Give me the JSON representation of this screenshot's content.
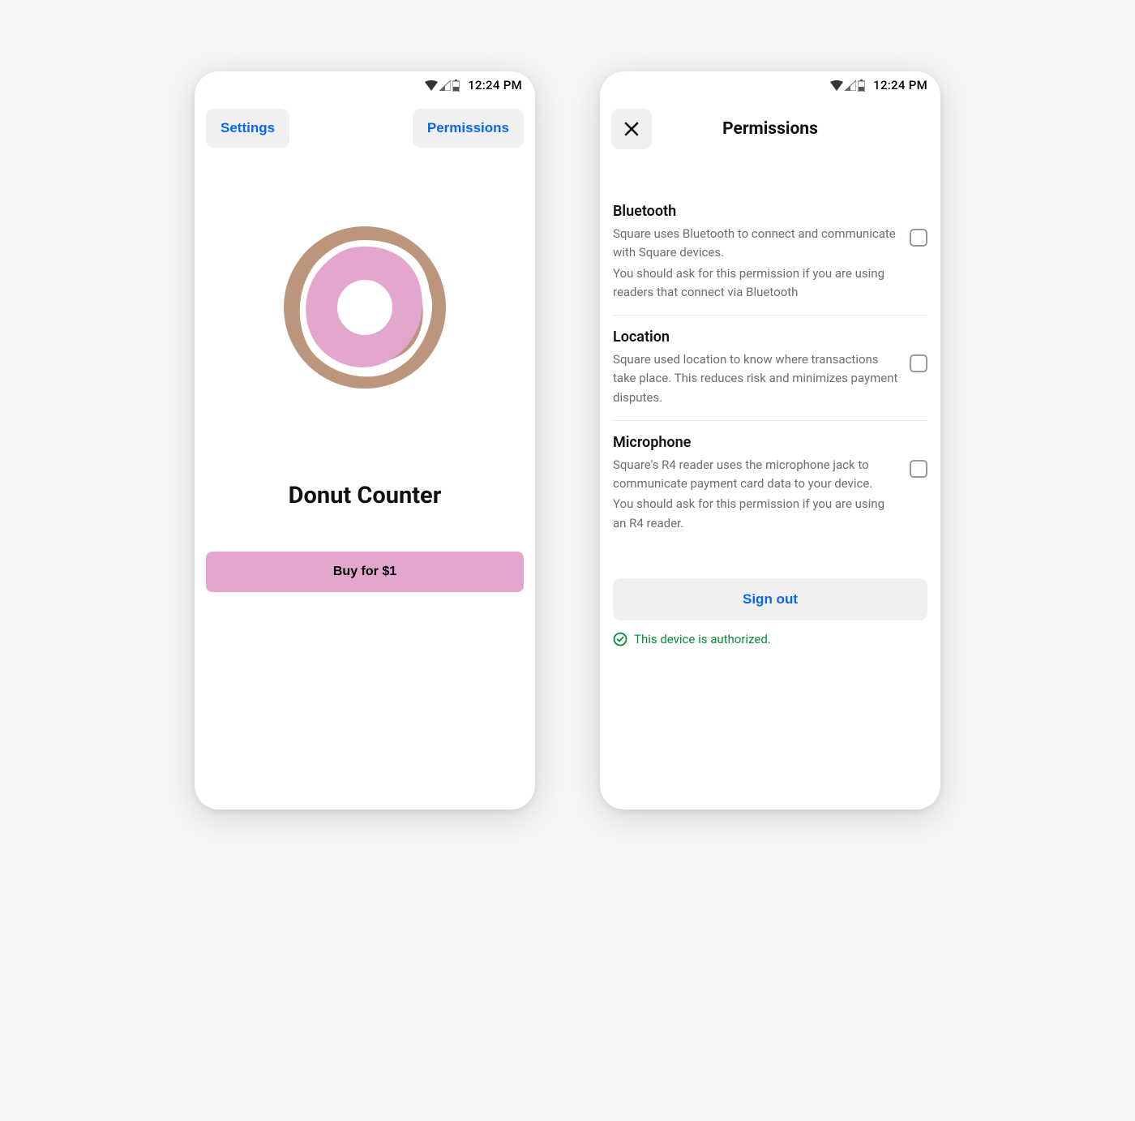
{
  "status": {
    "time": "12:24 PM"
  },
  "screen1": {
    "settings_label": "Settings",
    "permissions_label": "Permissions",
    "app_title": "Donut Counter",
    "buy_label": "Buy for $1"
  },
  "screen2": {
    "title": "Permissions",
    "items": [
      {
        "title": "Bluetooth",
        "desc1": "Square uses Bluetooth to connect and communicate with Square devices.",
        "desc2": "You should ask for this permission if you are using readers that connect via Bluetooth",
        "checked": false
      },
      {
        "title": "Location",
        "desc1": "Square used location to know where transactions take place. This reduces risk and minimizes payment disputes.",
        "desc2": "",
        "checked": false
      },
      {
        "title": "Microphone",
        "desc1": "Square's R4 reader uses the microphone jack to communicate payment card data to your device.",
        "desc2": "You should ask for this permission if you are using an R4 reader.",
        "checked": false
      }
    ],
    "signout_label": "Sign out",
    "auth_status": "This device is authorized."
  },
  "colors": {
    "accent_blue": "#0a66f5",
    "pink": "#e3a6cd",
    "green": "#0b8a3b"
  }
}
